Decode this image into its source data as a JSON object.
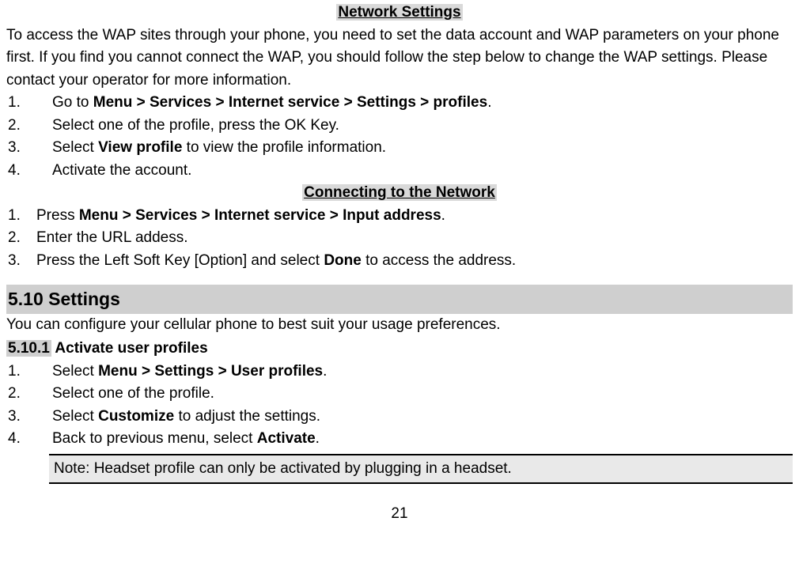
{
  "heading1": "Network Settings",
  "intro": "To access the WAP sites through your phone, you need to set the data account and WAP parameters on your phone first. If you find you cannot connect the WAP, you should follow the step below to change the WAP settings. Please contact your operator for more information.",
  "list1": {
    "n1": "1.",
    "t1a": "Go to ",
    "t1b": "Menu > Services > Internet service > Settings > profiles",
    "t1c": ".",
    "n2": "2.",
    "t2": "Select one of the profile, press the OK Key.",
    "n3": "3.",
    "t3a": "Select ",
    "t3b": "View profile",
    "t3c": " to view the profile information.",
    "n4": "4.",
    "t4": "Activate the account."
  },
  "heading2": "Connecting to the Network",
  "list2": {
    "n1": "1.",
    "t1a": "Press ",
    "t1b": "Menu > Services > Internet service > Input address",
    "t1c": ".",
    "n2": "2.",
    "t2": "Enter the URL addess.",
    "n3": "3.",
    "t3a": "Press the Left Soft Key [Option] and select ",
    "t3b": "Done",
    "t3c": " to access the address."
  },
  "section": {
    "title": "5.10 Settings",
    "intro": "You can configure your cellular phone to best suit your usage preferences.",
    "subnum": "5.10.1",
    "subtitle": " Activate user profiles"
  },
  "list3": {
    "n1": "1.",
    "t1a": "Select ",
    "t1b": "Menu > Settings > User profiles",
    "t1c": ".",
    "n2": "2.",
    "t2": "Select one of the profile.",
    "n3": "3.",
    "t3a": "Select ",
    "t3b": "Customize",
    "t3c": " to adjust the settings.",
    "n4": "4.",
    "t4a": "Back to previous menu, select ",
    "t4b": "Activate",
    "t4c": "."
  },
  "note": "Note: Headset profile can only be activated by plugging in a headset.",
  "page": "21"
}
